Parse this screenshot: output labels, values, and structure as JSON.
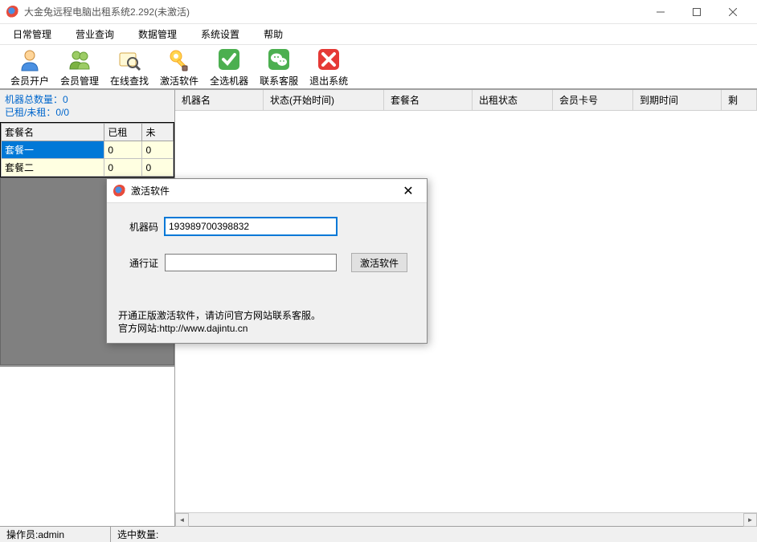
{
  "window": {
    "title": "大金兔远程电脑出租系统2.292(未激活)"
  },
  "menu": {
    "items": [
      "日常管理",
      "营业查询",
      "数据管理",
      "系统设置",
      "帮助"
    ]
  },
  "toolbar": {
    "items": [
      {
        "label": "会员开户",
        "icon": "user-add"
      },
      {
        "label": "会员管理",
        "icon": "user-group"
      },
      {
        "label": "在线查找",
        "icon": "search"
      },
      {
        "label": "激活软件",
        "icon": "key"
      },
      {
        "label": "全选机器",
        "icon": "check"
      },
      {
        "label": "联系客服",
        "icon": "wechat"
      },
      {
        "label": "退出系统",
        "icon": "exit"
      }
    ]
  },
  "sidebar": {
    "stats": {
      "total": "机器总数量：0",
      "rented": "已租/未租：0/0"
    },
    "table": {
      "headers": [
        "套餐名",
        "已租",
        "未"
      ],
      "rows": [
        {
          "name": "套餐一",
          "rented": "0",
          "free": "0"
        },
        {
          "name": "套餐二",
          "rented": "0",
          "free": "0"
        }
      ]
    }
  },
  "main_table": {
    "headers": [
      "机器名",
      "状态(开始时间)",
      "套餐名",
      "出租状态",
      "会员卡号",
      "到期时间",
      "剩"
    ]
  },
  "dialog": {
    "title": "激活软件",
    "machine_code_label": "机器码",
    "machine_code_value": "193989700398832",
    "passport_label": "通行证",
    "passport_value": "",
    "activate_btn": "激活软件",
    "footer_line1": "开通正版激活软件，请访问官方网站联系客服。",
    "footer_line2_prefix": "官方网站:",
    "footer_url": "http://www.dajintu.cn"
  },
  "status": {
    "operator": "操作员:admin",
    "selected": "选中数量:"
  }
}
